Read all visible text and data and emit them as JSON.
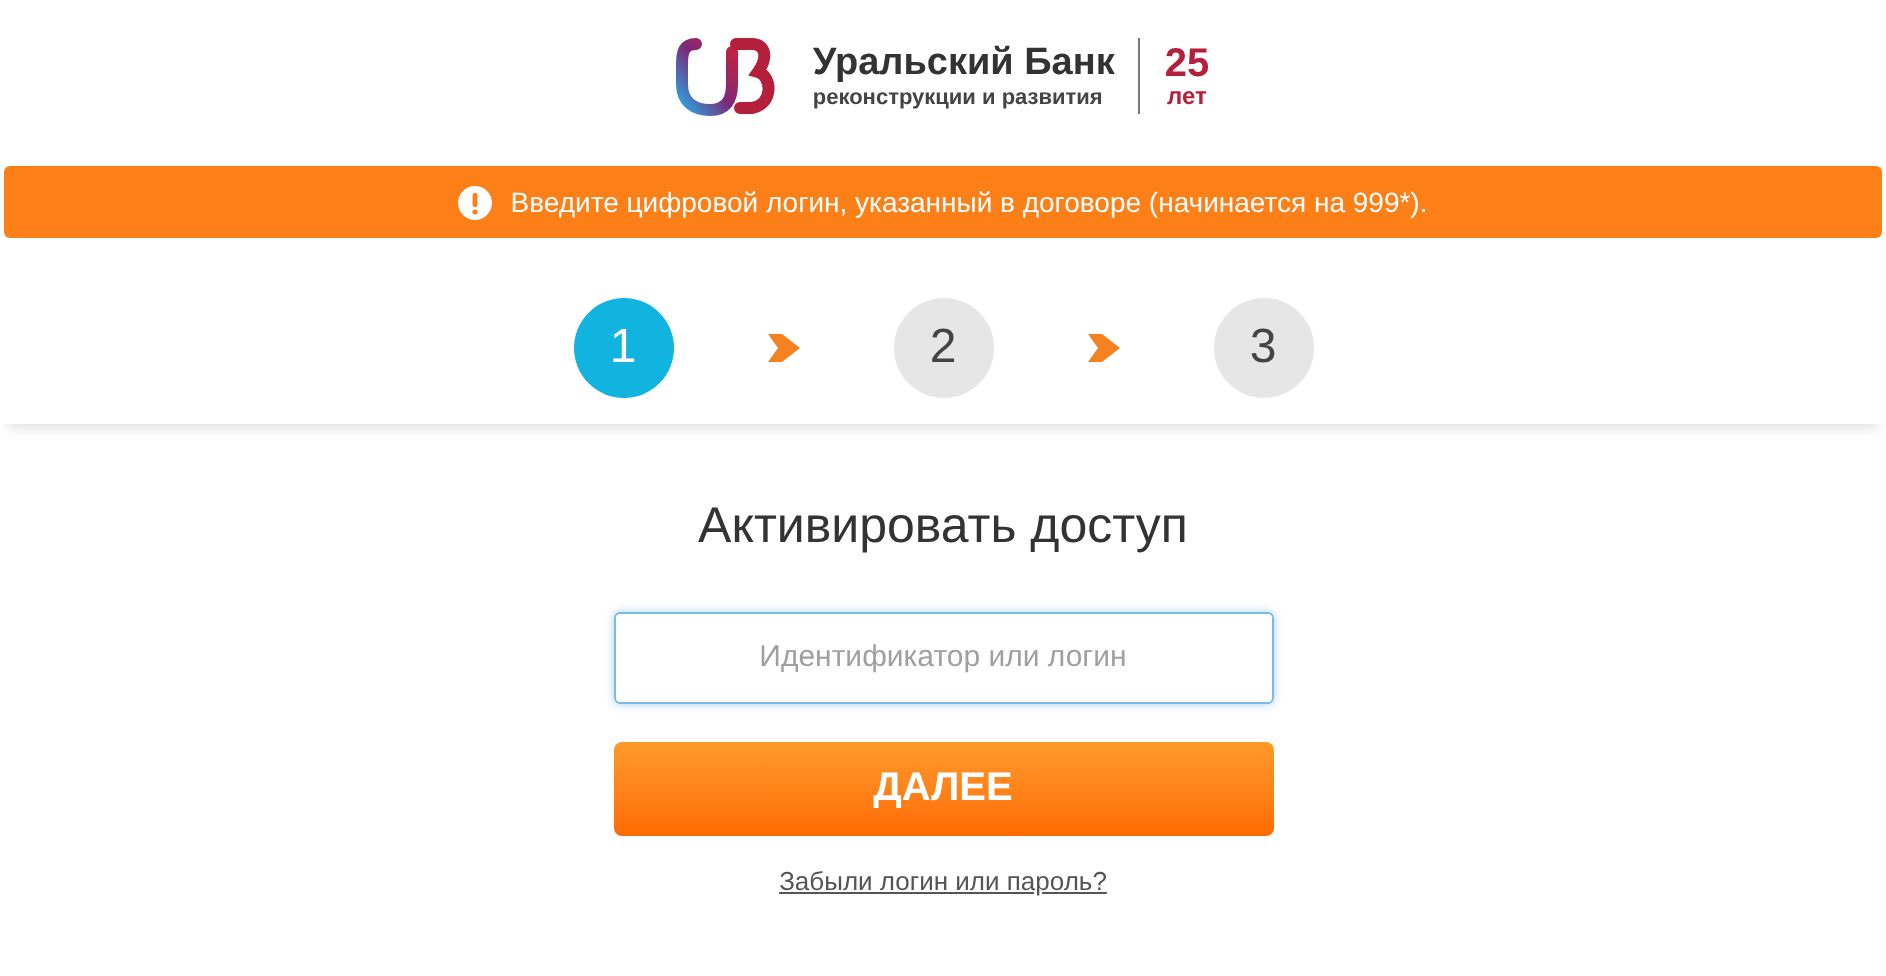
{
  "logo": {
    "name": "Уральский Банк",
    "subtitle": "реконструкции и развития",
    "anniversary": "25",
    "anniversary_unit": "лет"
  },
  "alert": {
    "text": "Введите цифровой логин, указанный в договоре (начинается на 999*)."
  },
  "steps": [
    {
      "label": "1",
      "selected": true
    },
    {
      "label": "2",
      "selected": false
    },
    {
      "label": "3",
      "selected": false
    }
  ],
  "title": "Активировать доступ",
  "login_field": {
    "placeholder": "Идентификатор или логин"
  },
  "submit_button": "ДАЛЕЕ",
  "forgot_link": "Забыли логин или пароль?"
}
